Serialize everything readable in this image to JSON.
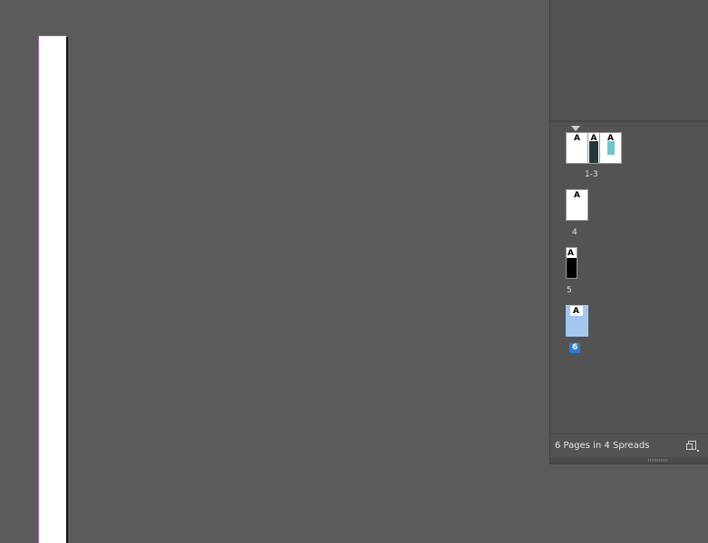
{
  "window": {
    "title": ""
  },
  "pages_panel": {
    "spreads": [
      {
        "label": "1-3",
        "pages": [
          {
            "prefix": "A",
            "fill": "#ffffff"
          },
          {
            "prefix": "A",
            "fill": "#24373a"
          },
          {
            "prefix": "A",
            "fill": "#6fc4c9"
          }
        ]
      },
      {
        "label": "4",
        "pages": [
          {
            "prefix": "A",
            "fill": "#ffffff"
          }
        ]
      },
      {
        "label": "5",
        "pages": [
          {
            "prefix": "A",
            "fill": "#000000"
          }
        ]
      },
      {
        "label": "6",
        "selected": true,
        "pages": [
          {
            "prefix": "A",
            "fill": "#a4c7f0"
          }
        ]
      }
    ],
    "footer_text": "6 Pages in 4 Spreads",
    "selected_label_bg": "#2e7bd6"
  },
  "colors": {
    "canvas_bg": "#5b5b5b",
    "panel_bg": "#535353",
    "page_edge": "#a35ab5"
  }
}
